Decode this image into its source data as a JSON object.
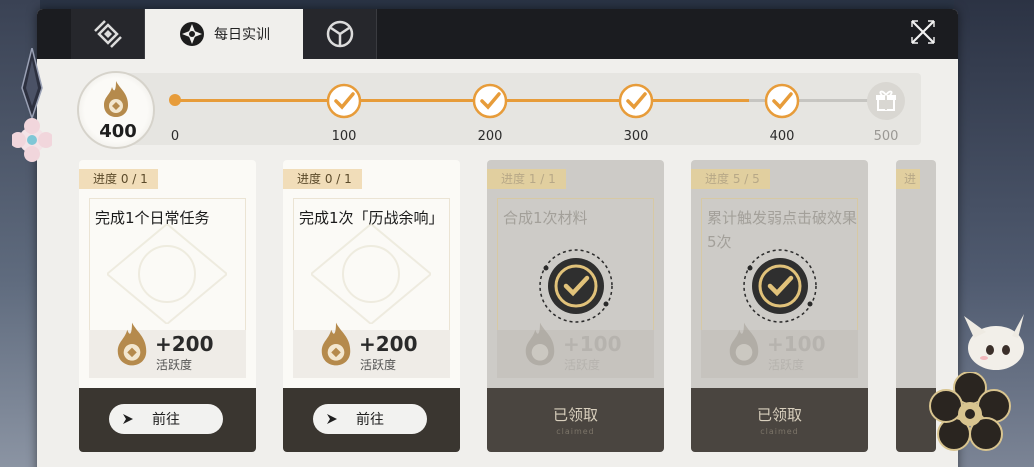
{
  "tabs": [
    {
      "icon": "inventory-icon",
      "label": ""
    },
    {
      "icon": "daily-training-icon",
      "label": "每日实训"
    },
    {
      "icon": "target-icon",
      "label": ""
    }
  ],
  "progress": {
    "current": "400",
    "current_value": 400,
    "max_value": 500,
    "milestones": [
      {
        "label": "0",
        "reached": true
      },
      {
        "label": "100",
        "reached": true
      },
      {
        "label": "200",
        "reached": true
      },
      {
        "label": "300",
        "reached": true
      },
      {
        "label": "400",
        "reached": true
      },
      {
        "label": "500",
        "reached": false,
        "icon": "gift-icon"
      }
    ]
  },
  "cards": [
    {
      "badge": "进度  0 / 1",
      "title": "完成1个日常任务",
      "reward_amount": "+200",
      "reward_name": "活跃度",
      "state": "todo",
      "button": "前往"
    },
    {
      "badge": "进度  0 / 1",
      "title": "完成1次「历战余响」",
      "reward_amount": "+200",
      "reward_name": "活跃度",
      "state": "todo",
      "button": "前往"
    },
    {
      "badge": "进度  1 / 1",
      "title": "合成1次材料",
      "reward_amount": "+100",
      "reward_name": "活跃度",
      "state": "claimed",
      "button": "已领取",
      "button_sub": "claimed"
    },
    {
      "badge": "进度  5 / 5",
      "title": "累计触发弱点击破效果5次",
      "reward_amount": "+100",
      "reward_name": "活跃度",
      "state": "claimed",
      "button": "已领取",
      "button_sub": "claimed"
    }
  ],
  "colors": {
    "accent": "#e79c3a",
    "panel": "#f0efec",
    "tabbar": "#1b1c20",
    "footer": "#3a3630"
  }
}
